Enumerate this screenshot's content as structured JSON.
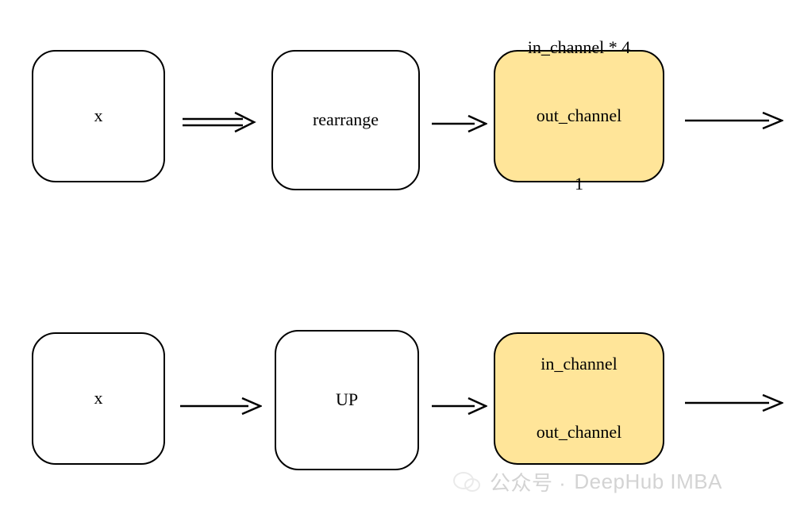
{
  "row1": {
    "input": "x",
    "middle": "rearrange",
    "right_line1": "in_channel * 4",
    "right_line2": "out_channel",
    "right_line3": "1"
  },
  "row2": {
    "input": "x",
    "middle": "UP",
    "right_line1": "in_channel",
    "right_line2": "out_channel"
  },
  "watermark": {
    "prefix": "公众号 ·",
    "name": "DeepHub IMBA"
  }
}
